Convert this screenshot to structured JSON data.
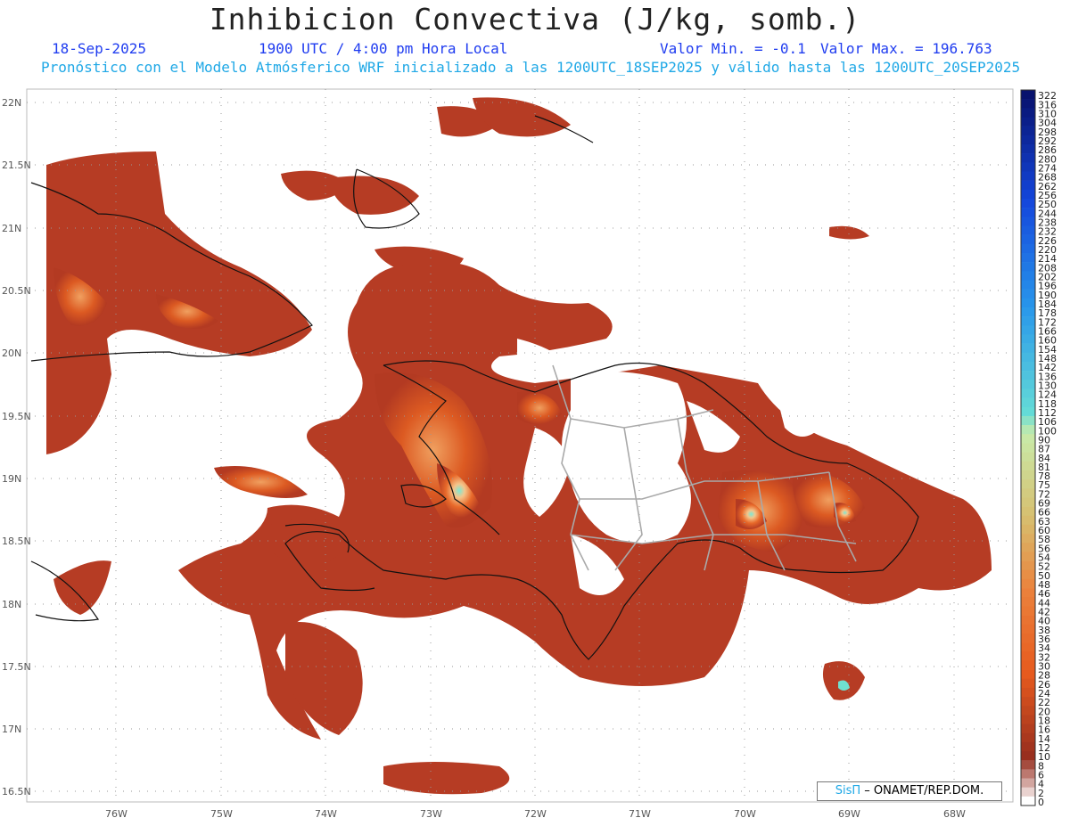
{
  "header": {
    "title": "Inhibicion Convectiva (J/kg, somb.)",
    "date": "18-Sep-2025",
    "time": "1900 UTC / 4:00 pm Hora Local",
    "valor_min": "Valor Min. = -0.1",
    "valor_max": "Valor Max. = 196.763",
    "subtitle": "Pronóstico con el Modelo Atmósferico WRF inicializado a las 1200UTC_18SEP2025 y válido hasta las  1200UTC_20SEP2025"
  },
  "map": {
    "lat_labels": [
      "22N",
      "21.5N",
      "21N",
      "20.5N",
      "20N",
      "19.5N",
      "19N",
      "18.5N",
      "18N",
      "17.5N",
      "17N",
      "16.5N"
    ],
    "lon_labels": [
      "76W",
      "75W",
      "74W",
      "73W",
      "72W",
      "71W",
      "70W",
      "69W",
      "68W"
    ],
    "field_colors": {
      "low": "#b33a22",
      "mid": "#e06520",
      "high": "#f2b070",
      "peak": "#6fe0d0"
    }
  },
  "colorbar": {
    "levels": [
      "322",
      "316",
      "310",
      "304",
      "298",
      "292",
      "286",
      "280",
      "274",
      "268",
      "262",
      "256",
      "250",
      "244",
      "238",
      "232",
      "226",
      "220",
      "214",
      "208",
      "202",
      "196",
      "190",
      "184",
      "178",
      "172",
      "166",
      "160",
      "154",
      "148",
      "142",
      "136",
      "130",
      "124",
      "118",
      "112",
      "106",
      "100",
      "90",
      "87",
      "84",
      "81",
      "78",
      "75",
      "72",
      "69",
      "66",
      "63",
      "60",
      "58",
      "56",
      "54",
      "52",
      "50",
      "48",
      "46",
      "44",
      "42",
      "40",
      "38",
      "36",
      "34",
      "32",
      "30",
      "28",
      "26",
      "24",
      "22",
      "20",
      "18",
      "16",
      "14",
      "12",
      "10",
      "8",
      "6",
      "4",
      "2",
      "0"
    ]
  },
  "credit": {
    "logo": "SisΠ",
    "text": "– ONAMET/REP.DOM."
  }
}
